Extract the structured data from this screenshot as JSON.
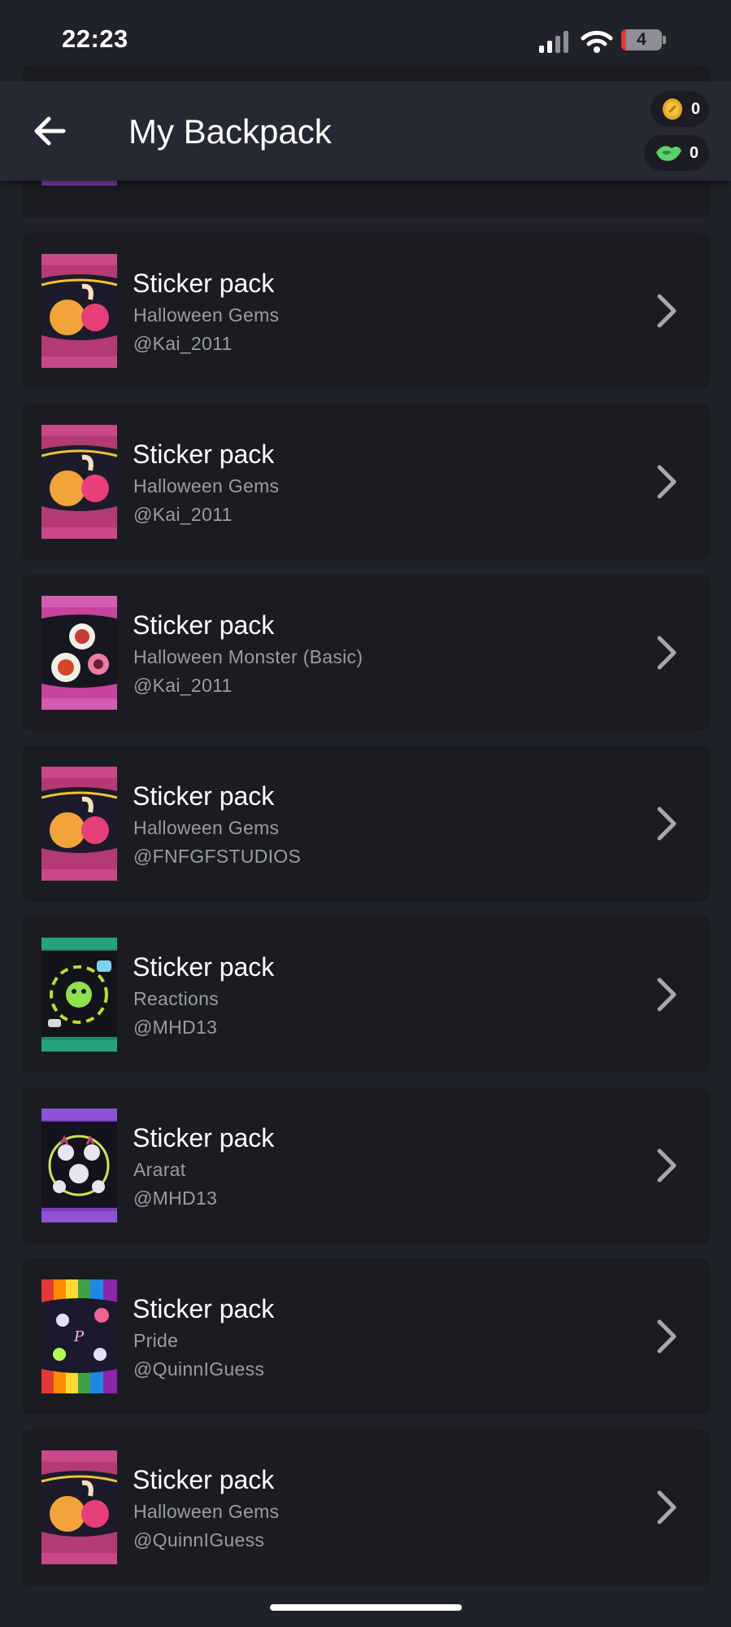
{
  "status_bar": {
    "time": "22:23",
    "battery_level": "4",
    "icons": [
      "cellular-signal-icon",
      "wifi-icon",
      "battery-icon"
    ]
  },
  "header": {
    "title": "My Backpack",
    "back_icon": "arrow-left-icon",
    "currencies": [
      {
        "name": "coin-icon",
        "amount": "0",
        "color": "#e8a91f"
      },
      {
        "name": "gem-icon",
        "amount": "0",
        "color": "#5bd16a"
      }
    ]
  },
  "items": [
    {
      "title": "Sticker pack",
      "subtitle": "Halloween Gems",
      "user": "@Kai_2011",
      "theme": "gems"
    },
    {
      "title": "Sticker pack",
      "subtitle": "Halloween Gems",
      "user": "@Kai_2011",
      "theme": "gems"
    },
    {
      "title": "Sticker pack",
      "subtitle": "Halloween Monster (Basic)",
      "user": "@Kai_2011",
      "theme": "monster"
    },
    {
      "title": "Sticker pack",
      "subtitle": "Halloween Gems",
      "user": "@FNFGFSTUDIOS",
      "theme": "gems"
    },
    {
      "title": "Sticker pack",
      "subtitle": "Reactions",
      "user": "@MHD13",
      "theme": "reactions"
    },
    {
      "title": "Sticker pack",
      "subtitle": "Ararat",
      "user": "@MHD13",
      "theme": "ararat"
    },
    {
      "title": "Sticker pack",
      "subtitle": "Pride",
      "user": "@QuinnIGuess",
      "theme": "pride"
    },
    {
      "title": "Sticker pack",
      "subtitle": "Halloween Gems",
      "user": "@QuinnIGuess",
      "theme": "gems"
    }
  ],
  "colors": {
    "background": "#202229",
    "header": "#262933",
    "card": "#1a1c22",
    "secondary_text": "#9a9ca3"
  }
}
